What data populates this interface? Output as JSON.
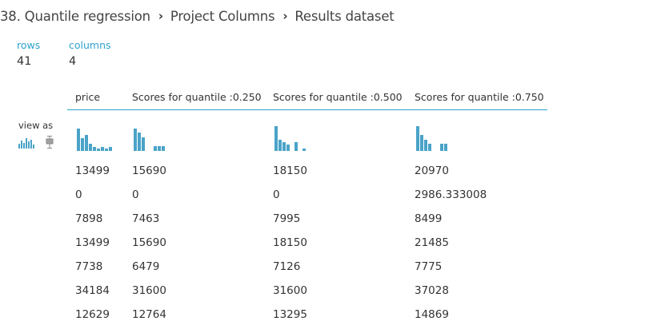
{
  "breadcrumb": [
    "38. Quantile regression",
    "Project Columns",
    "Results dataset"
  ],
  "stats": {
    "rows_label": "rows",
    "rows_value": "41",
    "columns_label": "columns",
    "columns_value": "4"
  },
  "view_as": {
    "label": "view as",
    "icons": [
      "histogram-icon",
      "boxplot-icon"
    ]
  },
  "colors": {
    "accent": "#2ea2cc",
    "bars": "#4aa3c8",
    "text": "#333333"
  },
  "table": {
    "columns": [
      "price",
      "Scores for quantile :0.250",
      "Scores for quantile :0.500",
      "Scores for quantile :0.750"
    ],
    "histograms": [
      [
        0.9,
        0.5,
        0.65,
        0.3,
        0.15,
        0.1,
        0.15,
        0.1,
        0.15
      ],
      [
        0.9,
        0.75,
        0.55,
        0,
        0,
        0.2,
        0.2,
        0.2
      ],
      [
        1.0,
        0.45,
        0.35,
        0.25,
        0,
        0.35,
        0,
        0.1
      ],
      [
        1.0,
        0.65,
        0.45,
        0.3,
        0,
        0,
        0.3,
        0.3
      ]
    ],
    "rows": [
      [
        "13499",
        "15690",
        "18150",
        "20970"
      ],
      [
        "0",
        "0",
        "0",
        "2986.333008"
      ],
      [
        "7898",
        "7463",
        "7995",
        "8499"
      ],
      [
        "13499",
        "15690",
        "18150",
        "21485"
      ],
      [
        "7738",
        "6479",
        "7126",
        "7775"
      ],
      [
        "34184",
        "31600",
        "31600",
        "37028"
      ],
      [
        "12629",
        "12764",
        "13295",
        "14869"
      ]
    ]
  }
}
